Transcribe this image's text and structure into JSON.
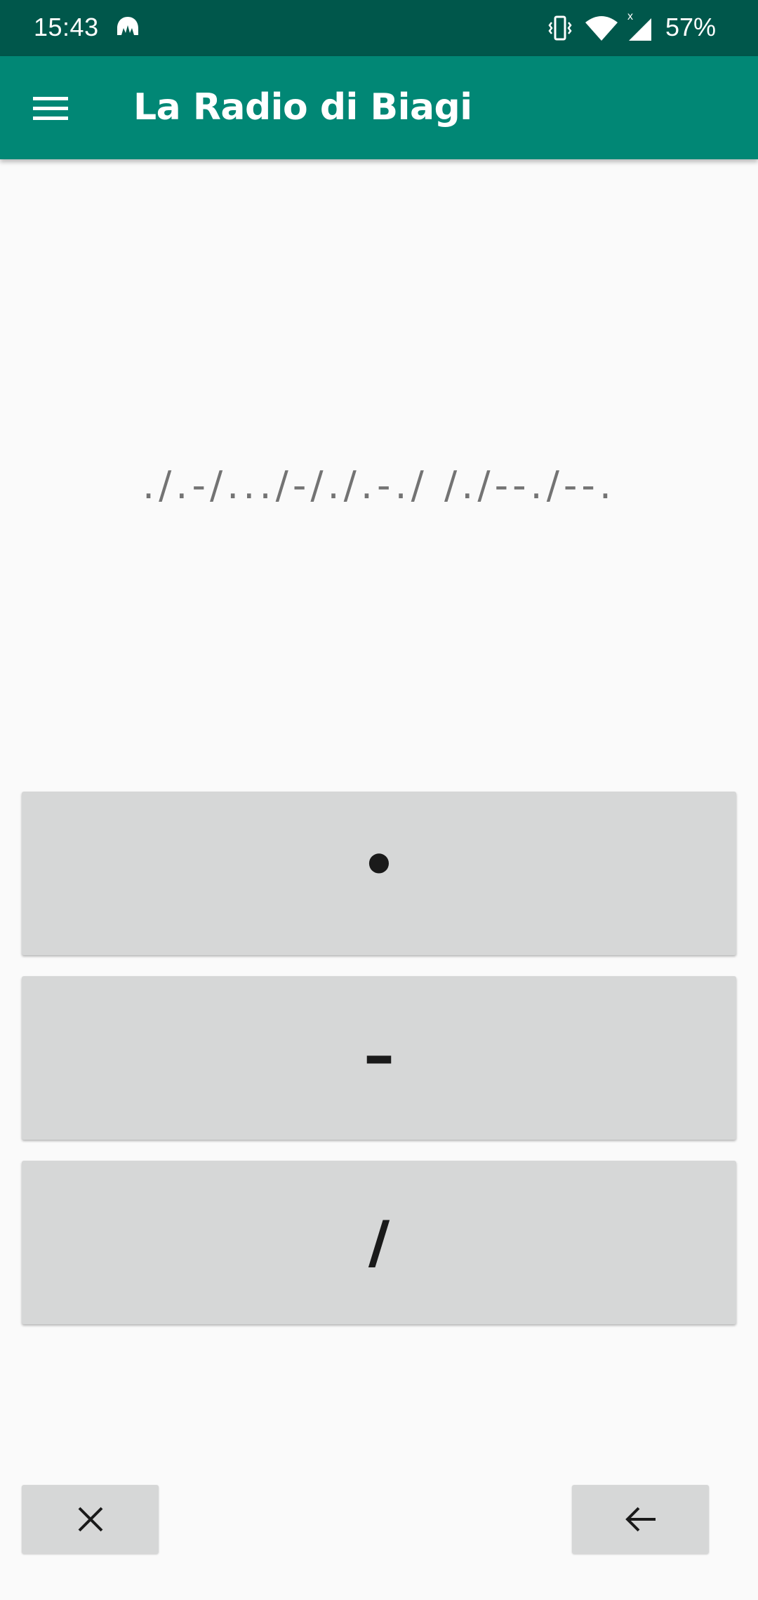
{
  "status_bar": {
    "time": "15:43",
    "battery": "57%",
    "icons": [
      "app-notification-icon",
      "vibrate-icon",
      "wifi-icon",
      "signal-icon"
    ]
  },
  "app_bar": {
    "title": "La Radio di Biagi",
    "menu_icon": "menu-icon"
  },
  "morse_display": {
    "text": "./.-/.../-/./.-./ /./--./--."
  },
  "keys": {
    "dot": "•",
    "dash": "–",
    "slash": "/"
  },
  "actions": {
    "clear_icon": "close-icon",
    "backspace_icon": "arrow-back-icon"
  },
  "colors": {
    "status_bar": "#00574b",
    "app_bar": "#018775",
    "button": "#d6d7d7",
    "background": "#fafafa",
    "morse_text": "#737373"
  }
}
